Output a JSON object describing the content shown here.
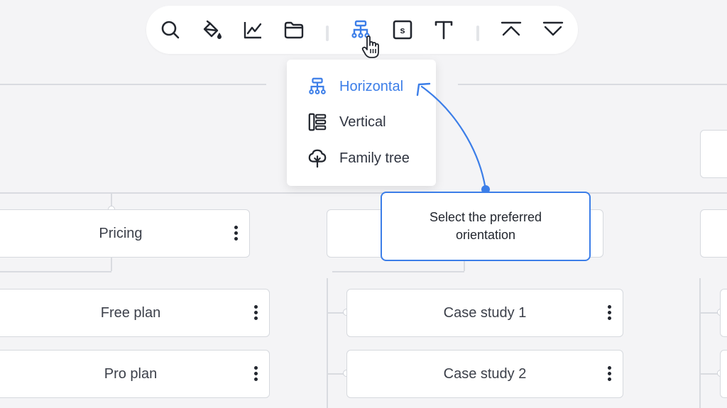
{
  "toolbar": {
    "buttons": [
      {
        "name": "search",
        "icon": "search-icon"
      },
      {
        "name": "fill",
        "icon": "paint-bucket-icon"
      },
      {
        "name": "chart",
        "icon": "line-chart-icon"
      },
      {
        "name": "folder",
        "icon": "folder-icon"
      },
      {
        "name": "layout",
        "icon": "org-chart-icon",
        "active": true
      },
      {
        "name": "shape",
        "icon": "s-box-icon"
      },
      {
        "name": "text",
        "icon": "text-icon"
      },
      {
        "name": "collapse",
        "icon": "chevron-up-bar-icon"
      },
      {
        "name": "expand",
        "icon": "chevron-down-bar-icon"
      }
    ]
  },
  "orientation_menu": {
    "items": [
      {
        "label": "Horizontal",
        "icon": "horizontal-tree-icon",
        "active": true
      },
      {
        "label": "Vertical",
        "icon": "vertical-tree-icon",
        "active": false
      },
      {
        "label": "Family tree",
        "icon": "tree-icon",
        "active": false
      }
    ]
  },
  "callout": {
    "text": "Select the preferred orientation"
  },
  "cards": {
    "pricing": "Pricing",
    "free_plan": "Free plan",
    "pro_plan": "Pro plan",
    "case_study_1": "Case study 1",
    "case_study_2": "Case study 2"
  },
  "colors": {
    "accent": "#3c7ee8",
    "background": "#f4f4f6",
    "card_border": "#d6d9de",
    "text": "#2f3440"
  }
}
